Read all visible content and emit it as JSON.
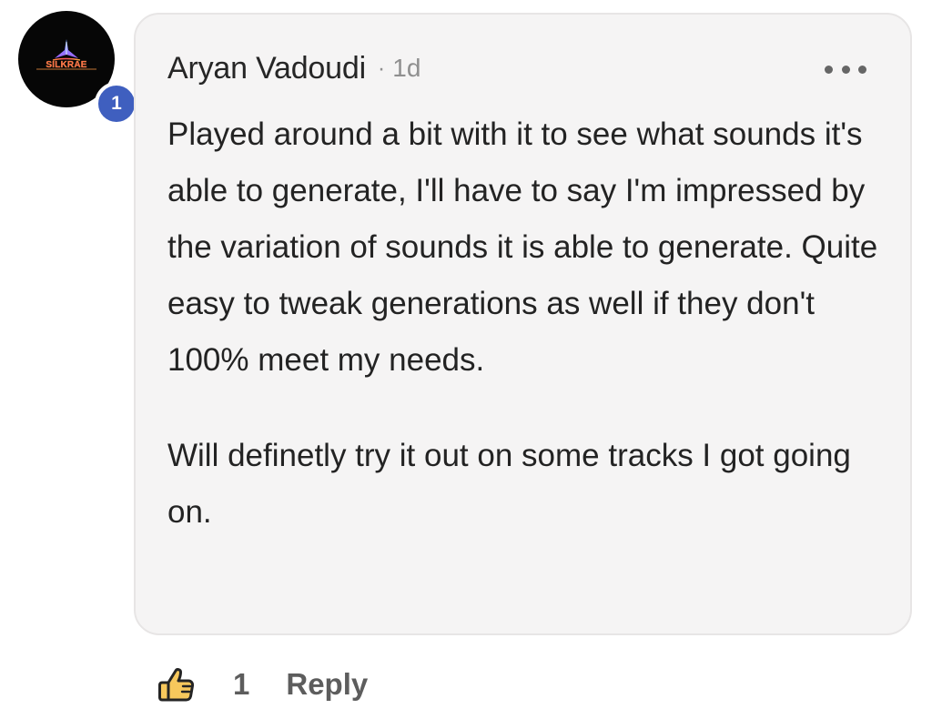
{
  "comment": {
    "avatar": {
      "logo_text": "SILKRAE",
      "badge": "1"
    },
    "author": "Aryan Vadoudi",
    "separator": "·",
    "time": "1d",
    "paragraphs": [
      "Played around a bit with it to see what sounds it's able to generate, I'll have to say I'm impressed by the variation of sounds it is able to generate. Quite easy to tweak generations as well if they don't 100% meet my needs.",
      "Will definetly try it out on some tracks I got going on."
    ]
  },
  "actions": {
    "like_count": "1",
    "reply_label": "Reply"
  },
  "colors": {
    "bubble_background": "#f5f4f4",
    "bubble_border": "#e7e5e5",
    "badge": "#3f5fbf",
    "like_icon_fill": "#f7c85c",
    "text": "#232323",
    "muted_text": "#8f8f8f",
    "action_text": "#5d5d5d"
  },
  "icons": {
    "menu": "more-horizontal-icon",
    "like": "thumbs-up-icon"
  }
}
